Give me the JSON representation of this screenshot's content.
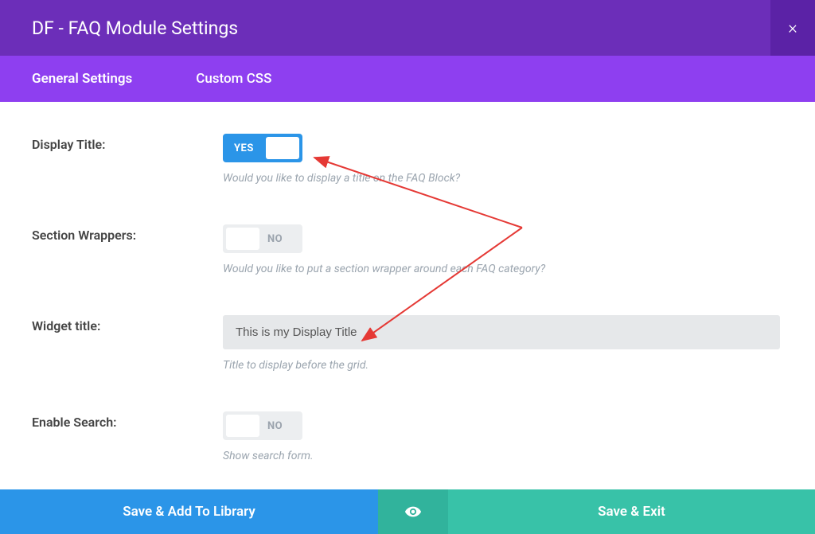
{
  "header": {
    "title": "DF - FAQ Module Settings",
    "close_icon": "×"
  },
  "tabs": {
    "general": "General Settings",
    "custom_css": "Custom CSS"
  },
  "fields": {
    "display_title": {
      "label": "Display Title:",
      "value": "YES",
      "help": "Would you like to display a title on the FAQ Block?"
    },
    "section_wrappers": {
      "label": "Section Wrappers:",
      "value": "NO",
      "help": "Would you like to put a section wrapper around each FAQ category?"
    },
    "widget_title": {
      "label": "Widget title:",
      "value": "This is my Display Title",
      "help": "Title to display before the grid."
    },
    "enable_search": {
      "label": "Enable Search:",
      "value": "NO",
      "help": "Show search form."
    }
  },
  "footer": {
    "save_library": "Save & Add To Library",
    "save_exit": "Save & Exit"
  }
}
